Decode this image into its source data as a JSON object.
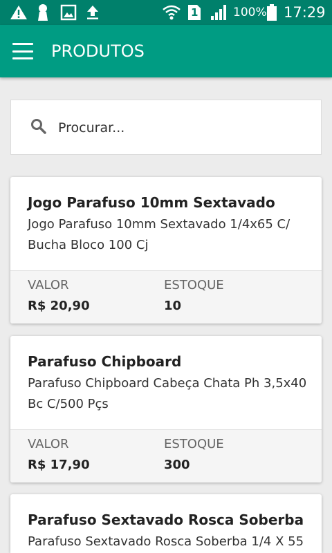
{
  "status_bar": {
    "battery": "100%",
    "time": "17:29",
    "sim": "1",
    "icons": [
      "warning-icon",
      "keyhole-icon",
      "image-icon",
      "upload-icon",
      "wifi-icon",
      "sim-icon",
      "signal-icon",
      "battery-icon"
    ]
  },
  "app_bar": {
    "title": "PRODUTOS",
    "menu_icon": "hamburger-menu-icon"
  },
  "search": {
    "placeholder": "Procurar...",
    "value": ""
  },
  "labels": {
    "valor": "VALOR",
    "estoque": "ESTOQUE"
  },
  "products": [
    {
      "title": "Jogo Parafuso 10mm Sextavado",
      "description": "Jogo Parafuso 10mm Sextavado 1/4x65 C/ Bucha Bloco 100 Cj",
      "valor": "R$ 20,90",
      "estoque": "10"
    },
    {
      "title": "Parafuso Chipboard",
      "description": "Parafuso Chipboard Cabeça Chata Ph 3,5x40 Bc C/500 Pçs",
      "valor": "R$ 17,90",
      "estoque": "300"
    },
    {
      "title": "Parafuso Sextavado Rosca Soberba",
      "description": "Parafuso Sextavado Rosca Soberba 1/4 X 55",
      "valor": "",
      "estoque": ""
    }
  ],
  "colors": {
    "status_bar": "#00806b",
    "app_bar": "#009c83",
    "background": "#ececec"
  }
}
